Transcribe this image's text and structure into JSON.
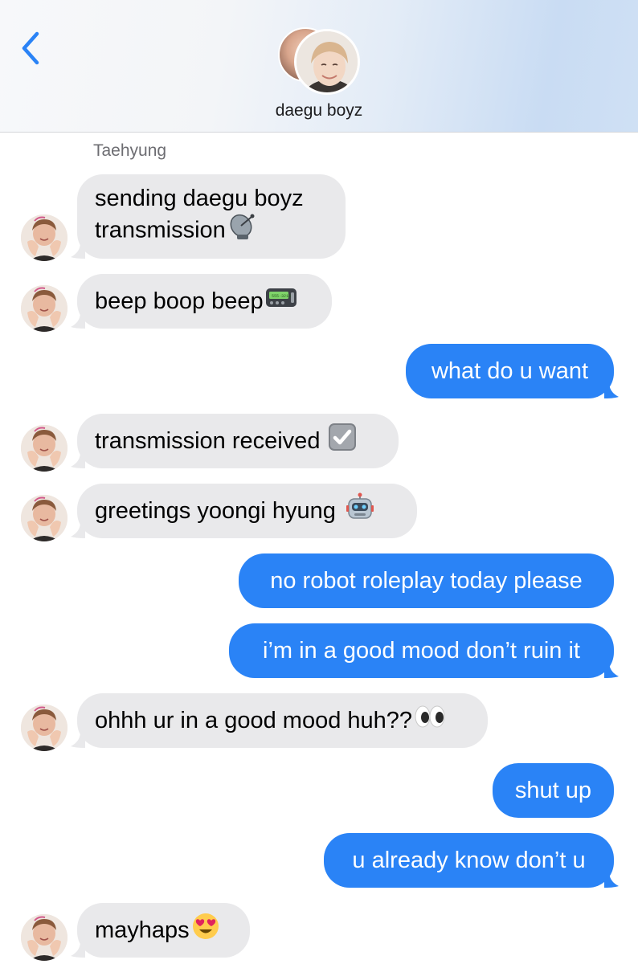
{
  "header": {
    "group_name": "daegu boyz",
    "back_label": "Back"
  },
  "sender": "Taehyung",
  "colors": {
    "incoming_bubble": "#e9e9eb",
    "outgoing_bubble": "#2a83f6",
    "accent": "#2a83f6"
  },
  "messages": [
    {
      "dir": "in",
      "lines": [
        "sending daegu boyz",
        "transmission"
      ],
      "emoji": "satellite-antenna"
    },
    {
      "dir": "in",
      "text": "beep boop beep",
      "emoji": "pager"
    },
    {
      "dir": "out",
      "text": "what do u want"
    },
    {
      "dir": "in",
      "text": "transmission received",
      "emoji": "check-box"
    },
    {
      "dir": "in",
      "text": "greetings yoongi hyung",
      "emoji": "robot"
    },
    {
      "dir": "out",
      "text": "no robot roleplay today please"
    },
    {
      "dir": "out",
      "text": "i’m in a good mood don’t ruin it"
    },
    {
      "dir": "in",
      "text": "ohhh ur in a good mood huh??",
      "emoji": "eyes"
    },
    {
      "dir": "out",
      "text": "shut up"
    },
    {
      "dir": "out",
      "text": "u already know don’t u"
    },
    {
      "dir": "in",
      "text": "mayhaps",
      "emoji": "heart-eyes"
    }
  ]
}
